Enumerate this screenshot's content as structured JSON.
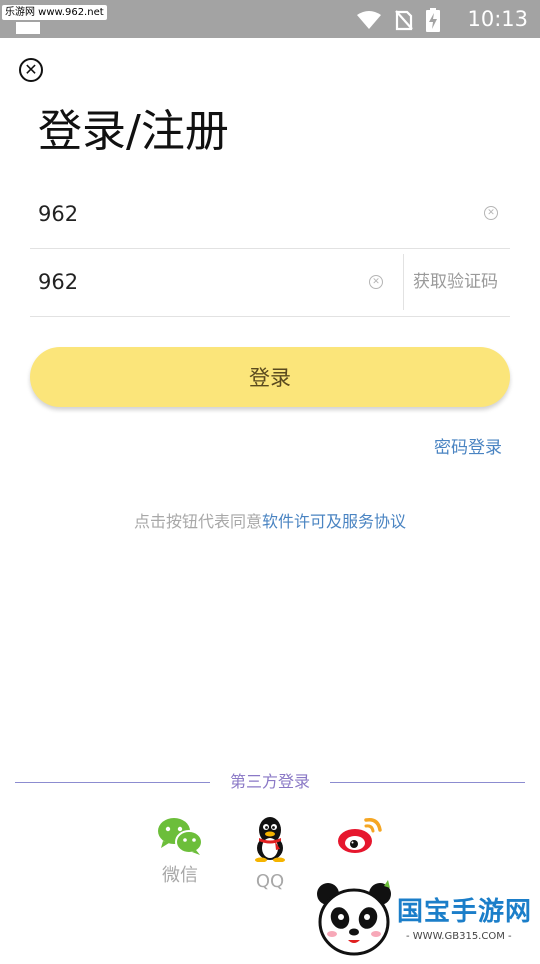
{
  "status_bar": {
    "watermark_text": "乐游网 www.962.net",
    "time": "10:13",
    "icons": [
      "wifi-icon",
      "no-signal-icon",
      "battery-charging-icon"
    ]
  },
  "header": {
    "close_icon": "close-icon",
    "title": "登录/注册"
  },
  "form": {
    "phone_value": "962",
    "code_value": "962",
    "get_code_label": "获取验证码",
    "login_button_label": "登录",
    "password_login_link": "密码登录"
  },
  "agreement": {
    "prefix": "点击按钮代表同意",
    "link_text": "软件许可及服务协议"
  },
  "third_party": {
    "label": "第三方登录",
    "options": [
      {
        "label": "微信",
        "icon": "wechat-icon"
      },
      {
        "label": "QQ",
        "icon": "qq-icon"
      },
      {
        "label": "",
        "icon": "weibo-icon"
      }
    ]
  },
  "watermark_brand": {
    "name": "国宝手游网",
    "url": "- WWW.GB315.COM -"
  },
  "colors": {
    "status_bar": "#a3a3a3",
    "login_button": "#fbe57a",
    "link": "#4a84c2",
    "third_party_accent": "#8a78c6"
  }
}
